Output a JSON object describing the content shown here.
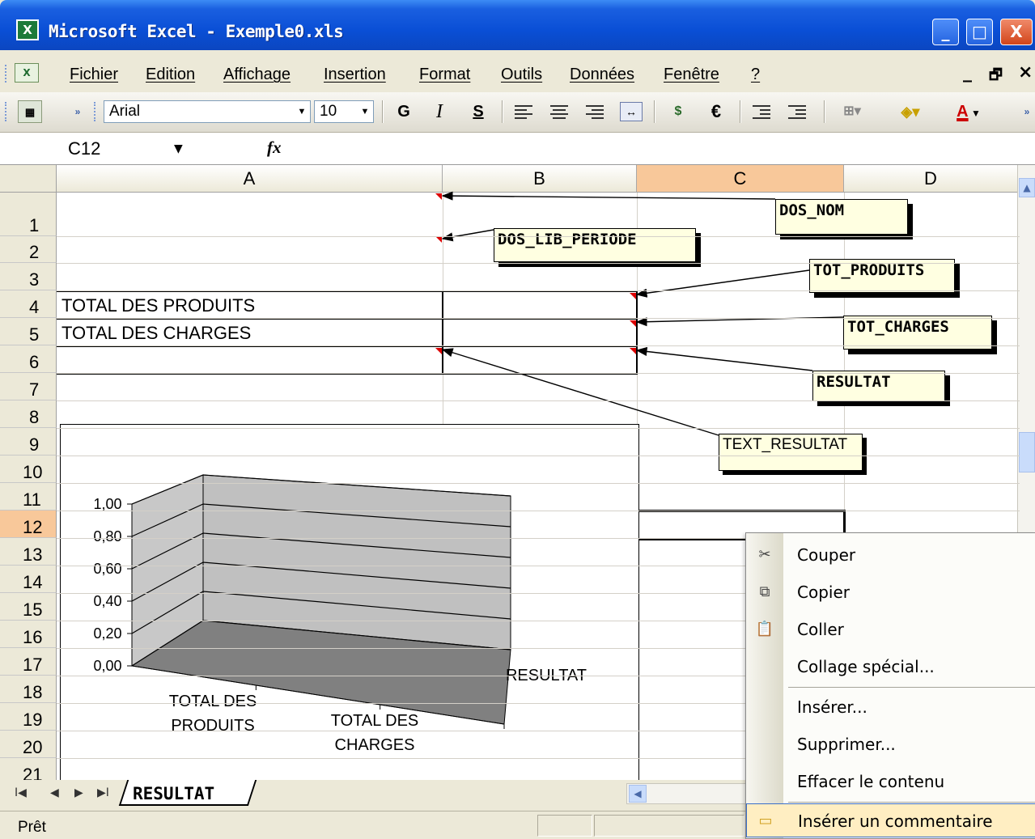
{
  "window": {
    "title": "Microsoft Excel - Exemple0.xls",
    "controls": [
      "_",
      "□",
      "X"
    ]
  },
  "menubar": {
    "items": [
      "Fichier",
      "Edition",
      "Affichage",
      "Insertion",
      "Format",
      "Outils",
      "Données",
      "Fenêtre",
      "?"
    ],
    "doc_controls": [
      "_",
      "🗗",
      "×"
    ]
  },
  "toolbar": {
    "font": "Arial",
    "size": "10",
    "bold": "G",
    "italic": "I",
    "underline": "S",
    "euro": "€",
    "font_color_letter": "A"
  },
  "formula_bar": {
    "name_box": "C12",
    "fx": "fx",
    "formula": ""
  },
  "columns": [
    "A",
    "B",
    "C",
    "D"
  ],
  "selected_column": "C",
  "rows": [
    "1",
    "2",
    "3",
    "4",
    "5",
    "6",
    "7",
    "8",
    "9",
    "10",
    "11",
    "12",
    "13",
    "14",
    "15",
    "16",
    "17",
    "18",
    "19",
    "20",
    "21"
  ],
  "selected_row": "12",
  "cells": {
    "A4": "TOTAL DES PRODUITS",
    "A5": "TOTAL DES CHARGES"
  },
  "comments": {
    "dos_nom": "DOS_NOM",
    "dos_lib_periode": "DOS_LIB_PERIODE",
    "tot_produits": "TOT_PRODUITS",
    "tot_charges": "TOT_CHARGES",
    "resultat": "RESULTAT",
    "text_resultat": "TEXT_RESULTAT"
  },
  "chart_data": {
    "type": "bar",
    "categories": [
      "TOTAL DES PRODUITS",
      "TOTAL DES CHARGES",
      "RESULTAT"
    ],
    "category_lines": [
      [
        "TOTAL DES",
        "PRODUITS"
      ],
      [
        "TOTAL DES",
        "CHARGES"
      ],
      [
        "RESULTAT"
      ]
    ],
    "values": [
      0,
      0,
      0
    ],
    "yticks": [
      "1,00",
      "0,80",
      "0,60",
      "0,40",
      "0,20",
      "0,00"
    ],
    "ylim": [
      0,
      1
    ],
    "title": "",
    "xlabel": "",
    "ylabel": "",
    "grid": true,
    "style": "3d"
  },
  "sheet_tabs": {
    "active": "RESULTAT"
  },
  "status": {
    "text": "Prêt"
  },
  "context_menu": {
    "items": [
      {
        "label": "Couper",
        "icon": "scissors-icon"
      },
      {
        "label": "Copier",
        "icon": "copy-icon"
      },
      {
        "label": "Coller",
        "icon": "paste-icon"
      },
      {
        "label": "Collage spécial...",
        "icon": ""
      },
      {
        "label": "Insérer...",
        "icon": ""
      },
      {
        "label": "Supprimer...",
        "icon": ""
      },
      {
        "label": "Effacer le contenu",
        "icon": ""
      },
      {
        "label": "Insérer un commentaire",
        "icon": "comment-icon"
      }
    ],
    "highlighted": "Insérer un commentaire"
  }
}
